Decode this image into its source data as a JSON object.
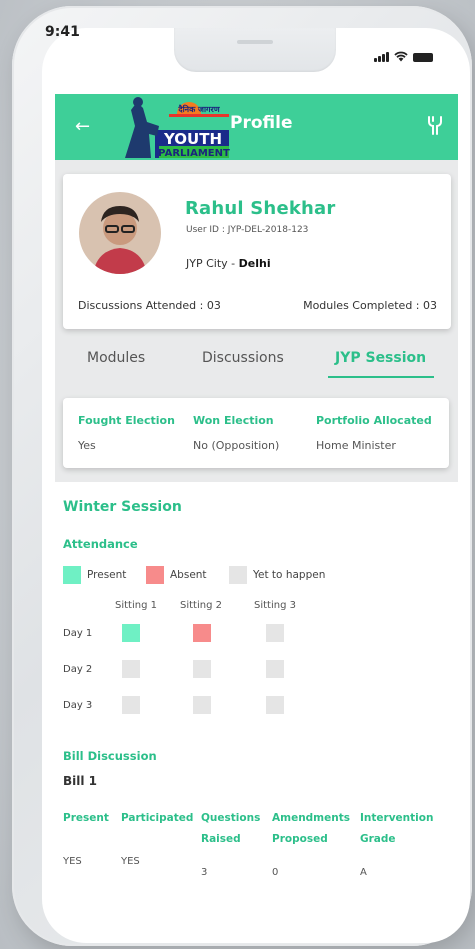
{
  "status": {
    "time": "9:41"
  },
  "appbar": {
    "title": "Profile",
    "logo_text_top": "दैनिक जागरण",
    "logo_text_mid": "YOUTH",
    "logo_text_bottom": "PARLIAMENT"
  },
  "profile": {
    "name": "Rahul Shekhar",
    "user_id": "User ID : JYP-DEL-2018-123",
    "city_label": "JYP City - ",
    "city_value": "Delhi",
    "discussions": "Discussions Attended : 03",
    "modules": "Modules Completed : 03"
  },
  "tabs": [
    {
      "label": "Modules"
    },
    {
      "label": "Discussions"
    },
    {
      "label": "JYP Session"
    }
  ],
  "election": {
    "headers": [
      "Fought Election",
      "Won Election",
      "Portfolio Allocated"
    ],
    "values": [
      "Yes",
      "No (Opposition)",
      "Home Minister"
    ]
  },
  "session": {
    "title": "Winter Session",
    "attendance_title": "Attendance",
    "legend": [
      {
        "label": "Present",
        "color": "#6ff0c4"
      },
      {
        "label": "Absent",
        "color": "#f78b8b"
      },
      {
        "label": "Yet to happen",
        "color": "#e5e5e5"
      }
    ],
    "sittings": [
      "Sitting 1",
      "Sitting 2",
      "Sitting 3"
    ],
    "days": [
      {
        "label": "Day 1",
        "status": [
          "present",
          "absent",
          "pending"
        ]
      },
      {
        "label": "Day 2",
        "status": [
          "pending",
          "pending",
          "pending"
        ]
      },
      {
        "label": "Day 3",
        "status": [
          "pending",
          "pending",
          "pending"
        ]
      }
    ]
  },
  "bill": {
    "section_title": "Bill Discussion",
    "name": "Bill 1",
    "headers": [
      [
        "Present"
      ],
      [
        "Participated"
      ],
      [
        "Questions",
        "Raised"
      ],
      [
        "Amendments",
        "Proposed"
      ],
      [
        "Intervention",
        "Grade"
      ]
    ],
    "values": [
      "YES",
      "YES",
      "3",
      "0",
      "A"
    ]
  }
}
